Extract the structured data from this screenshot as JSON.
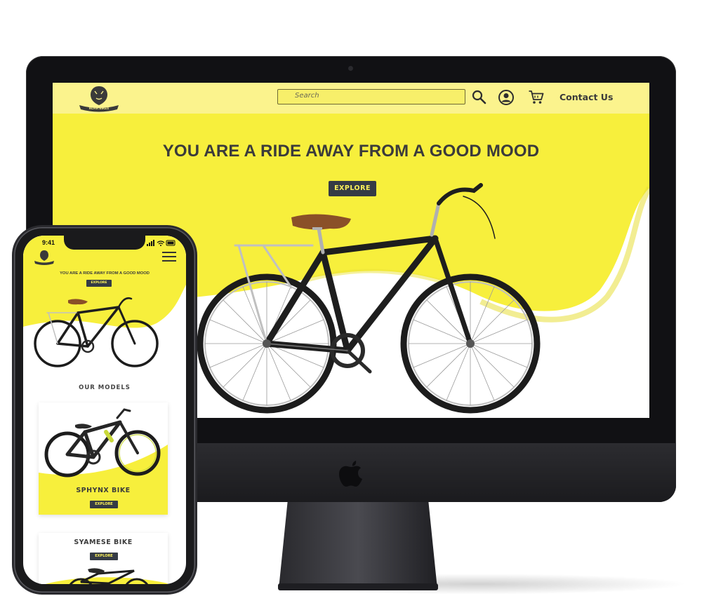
{
  "colors": {
    "accent": "#f7ef3c",
    "header": "#fbf38d",
    "button": "#353b45",
    "button_text": "#fbf15a",
    "text": "#3b3b3b"
  },
  "desktop": {
    "logo_text": "ROAR BIKES",
    "search_placeholder": "Search",
    "icons": [
      "search-icon",
      "user-icon",
      "cart-icon"
    ],
    "contact_label": "Contact Us",
    "hero_title": "YOU ARE A RIDE AWAY FROM A GOOD MOOD",
    "explore_label": "EXPLORE"
  },
  "mobile": {
    "status_time": "9:41",
    "hero_title": "YOU ARE A RIDE AWAY FROM A GOOD MOOD",
    "explore_label": "EXPLORE",
    "section_title": "OUR MODELS",
    "models": [
      {
        "name": "SPHYNX BIKE",
        "button": "EXPLORE"
      },
      {
        "name": "SYAMESE BIKE",
        "button": "EXPLORE"
      }
    ]
  }
}
